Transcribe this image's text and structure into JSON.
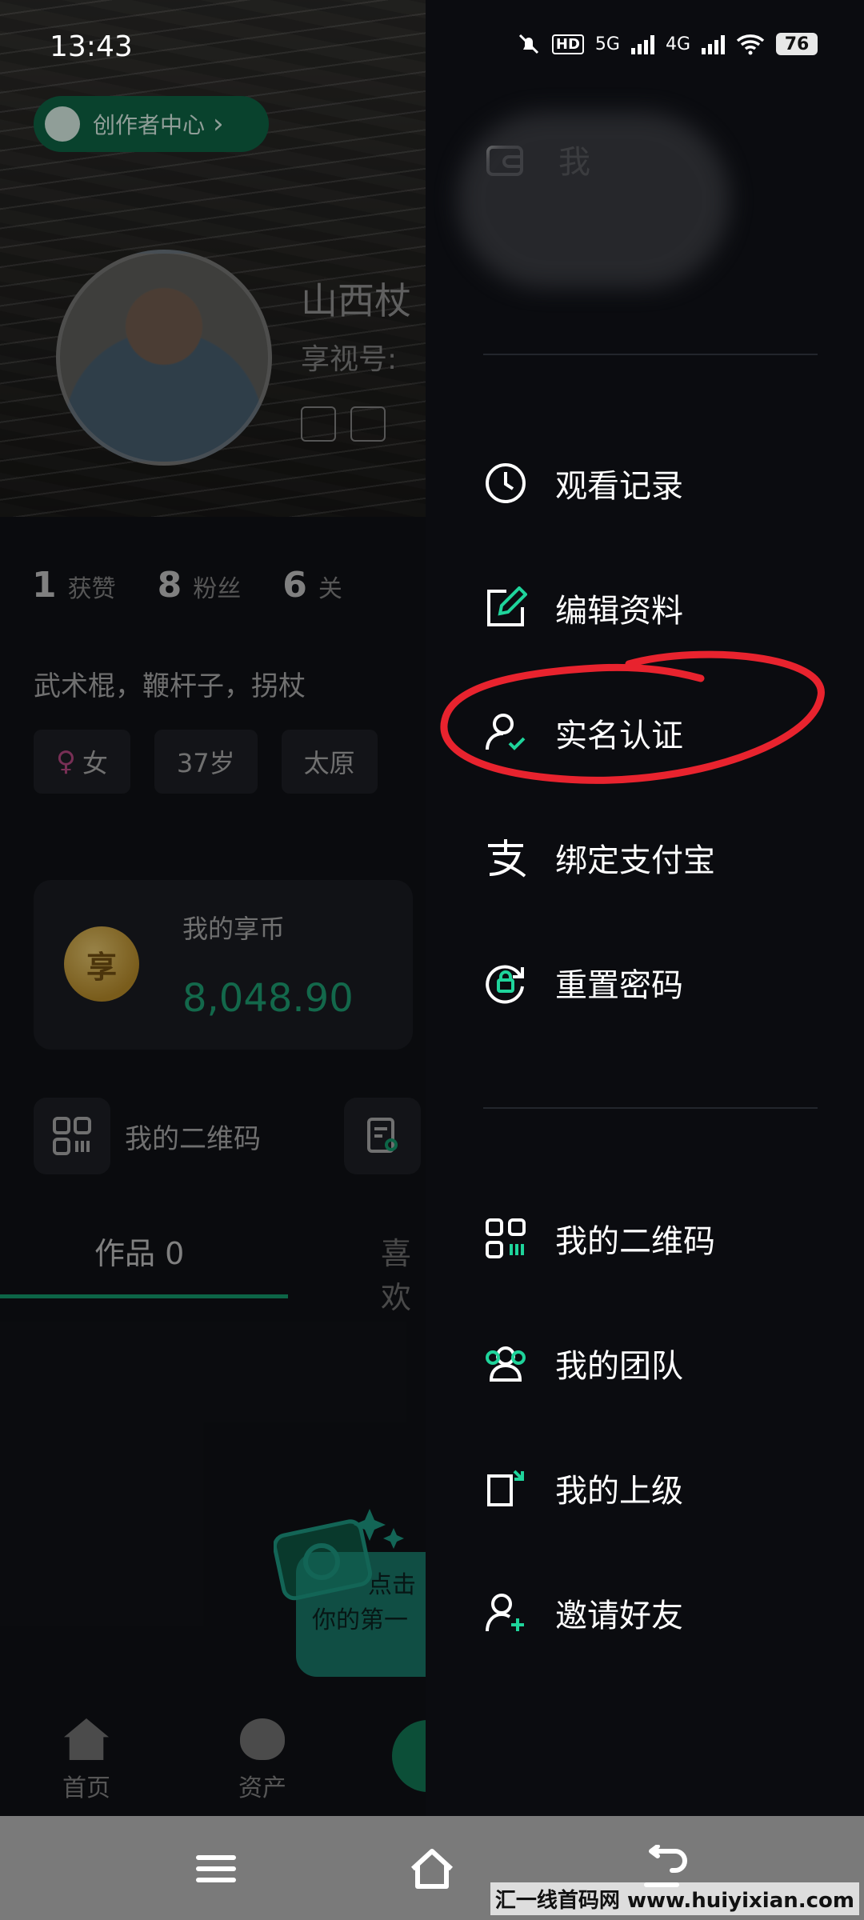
{
  "status_bar": {
    "time": "13:43",
    "hd": "HD",
    "net1": "5G",
    "net2": "4G",
    "battery": "76"
  },
  "profile": {
    "creator_center": "创作者中心",
    "name_partial": "山西杖",
    "id_label": "享视号:",
    "stats": [
      {
        "num": "1",
        "label": "获赞"
      },
      {
        "num": "8",
        "label": "粉丝"
      },
      {
        "num": "6",
        "label": "关"
      }
    ],
    "bio": "武术棍，鞭杆子，拐杖",
    "tags": [
      "女",
      "37岁",
      "太原"
    ],
    "coin_label": "我的享币",
    "coin_value": "8,048.90",
    "coin_glyph": "享",
    "qr_label": "我的二维码",
    "tab_works": "作品 0",
    "tab_likes": "喜欢",
    "promo_line1": "点击",
    "promo_line2": "你的第一",
    "nav_home": "首页",
    "nav_assets": "资产",
    "accent": "#16a373"
  },
  "drawer": {
    "top_partial": "我",
    "items": [
      {
        "label": "观看记录",
        "icon": "clock-icon"
      },
      {
        "label": "编辑资料",
        "icon": "edit-icon"
      },
      {
        "label": "实名认证",
        "icon": "verify-user-icon"
      },
      {
        "label": "绑定支付宝",
        "icon": "alipay-icon"
      },
      {
        "label": "重置密码",
        "icon": "reset-password-icon"
      },
      {
        "label": "我的二维码",
        "icon": "qr-code-icon"
      },
      {
        "label": "我的团队",
        "icon": "team-icon"
      },
      {
        "label": "我的上级",
        "icon": "superior-icon"
      },
      {
        "label": "邀请好友",
        "icon": "invite-friend-icon"
      }
    ],
    "highlight_color": "#e8232e"
  },
  "watermark": "汇一线首码网 www.huiyixian.com"
}
